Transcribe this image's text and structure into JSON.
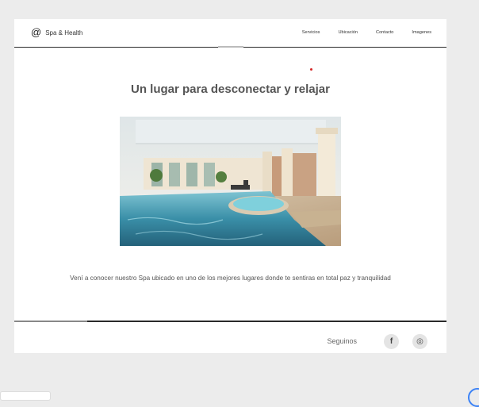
{
  "header": {
    "brand": "Spa & Health",
    "brand_icon": "at-icon",
    "menu": [
      "Servicios",
      "Ubicación",
      "Contacto",
      "Imagenes"
    ]
  },
  "main": {
    "title": "Un lugar para desconectar y relajar",
    "hero_image": "indoor-pool-photo",
    "description": "Vení a conocer nuestro Spa ubicado en uno de los mejores lugares donde te sentiras en total paz y tranquilidad"
  },
  "footer": {
    "follow_label": "Seguinos",
    "social": [
      {
        "icon": "facebook-icon",
        "glyph": "f"
      },
      {
        "icon": "instagram-icon",
        "glyph": "◎"
      }
    ]
  },
  "colors": {
    "background": "#ececec",
    "page": "#ffffff",
    "rule": "#2a2a2a",
    "accent_dot": "#d52828",
    "social_bg": "#e4e4e4"
  }
}
